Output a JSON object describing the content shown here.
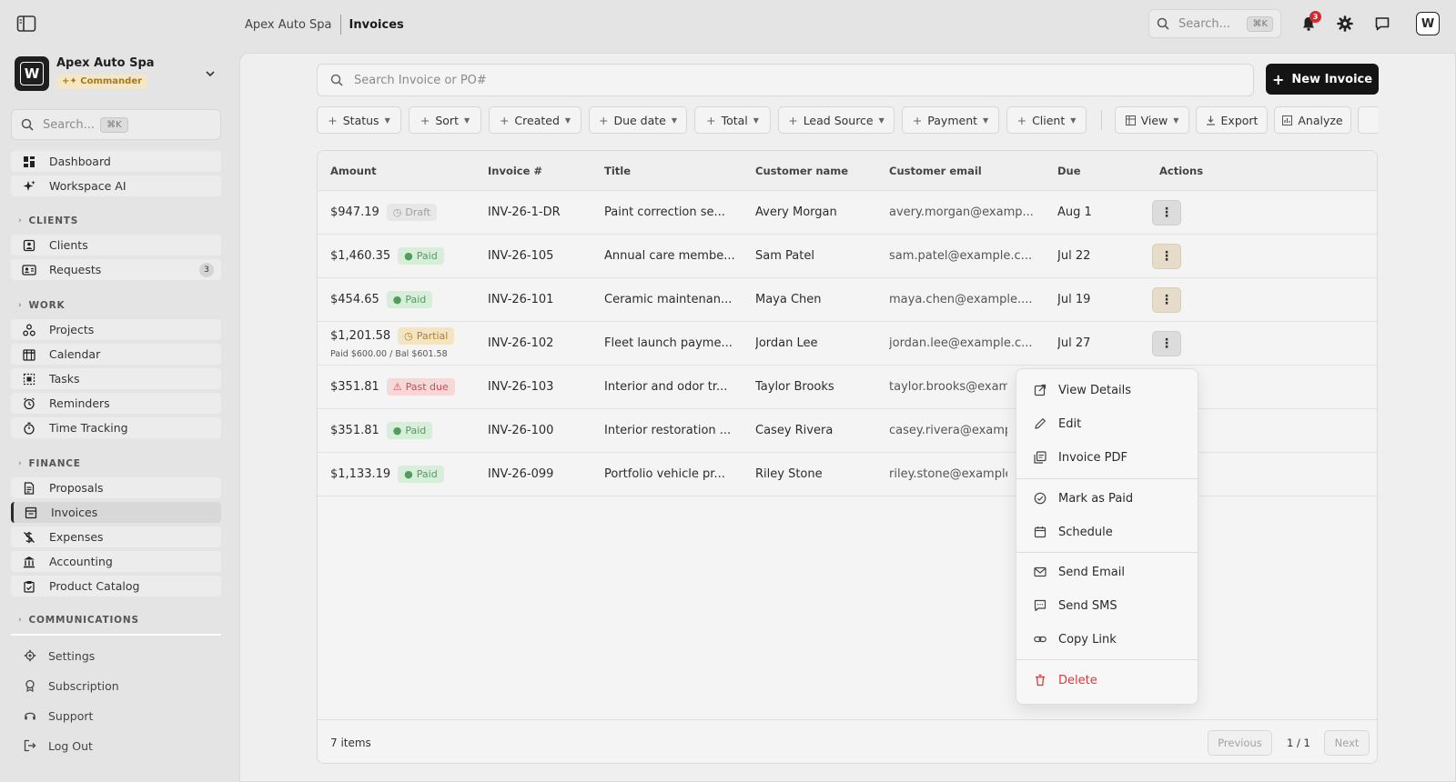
{
  "breadcrumb": {
    "org": "Apex Auto Spa",
    "page": "Invoices"
  },
  "topbar": {
    "search_placeholder": "Search...",
    "search_shortcut": "⌘K",
    "notification_count": "3",
    "avatar_letter": "W"
  },
  "workspace": {
    "name": "Apex Auto Spa",
    "role": "Commander",
    "logo_letter": "W"
  },
  "sidebar": {
    "search_placeholder": "Search...",
    "search_shortcut": "⌘K",
    "top_items": [
      {
        "label": "Dashboard",
        "icon": "dashboard-icon"
      },
      {
        "label": "Workspace AI",
        "icon": "sparkle-icon"
      }
    ],
    "sections": [
      {
        "title": "CLIENTS",
        "items": [
          {
            "label": "Clients"
          },
          {
            "label": "Requests",
            "count": "3"
          }
        ]
      },
      {
        "title": "WORK",
        "items": [
          {
            "label": "Projects"
          },
          {
            "label": "Calendar"
          },
          {
            "label": "Tasks"
          },
          {
            "label": "Reminders"
          },
          {
            "label": "Time Tracking"
          }
        ]
      },
      {
        "title": "FINANCE",
        "items": [
          {
            "label": "Proposals"
          },
          {
            "label": "Invoices"
          },
          {
            "label": "Expenses"
          },
          {
            "label": "Accounting"
          },
          {
            "label": "Product Catalog"
          }
        ]
      },
      {
        "title": "COMMUNICATIONS",
        "items": []
      }
    ],
    "footer": [
      {
        "label": "Settings"
      },
      {
        "label": "Subscription"
      },
      {
        "label": "Support"
      },
      {
        "label": "Log Out"
      }
    ]
  },
  "main": {
    "search_placeholder": "Search Invoice or PO#",
    "new_invoice_label": "New Invoice",
    "filters": [
      "Status",
      "Sort",
      "Created",
      "Due date",
      "Total",
      "Lead Source",
      "Payment",
      "Client"
    ],
    "view_label": "View",
    "export_label": "Export",
    "analyze_label": "Analyze"
  },
  "table": {
    "columns": [
      "Amount",
      "Invoice #",
      "Title",
      "Customer name",
      "Customer email",
      "Due",
      "Actions"
    ],
    "rows": [
      {
        "amount": "$947.19",
        "status": "Draft",
        "invoice": "INV-26-1-DR",
        "title": "Paint correction se...",
        "customer": "Avery Morgan",
        "email": "avery.morgan@examp...",
        "due": "Aug 1"
      },
      {
        "amount": "$1,460.35",
        "status": "Paid",
        "invoice": "INV-26-105",
        "title": "Annual care membe...",
        "customer": "Sam Patel",
        "email": "sam.patel@example.c...",
        "due": "Jul 22"
      },
      {
        "amount": "$454.65",
        "status": "Paid",
        "invoice": "INV-26-101",
        "title": "Ceramic maintenan...",
        "customer": "Maya Chen",
        "email": "maya.chen@example....",
        "due": "Jul 19"
      },
      {
        "amount": "$1,201.58",
        "status": "Partial",
        "sub": "Paid $600.00 / Bal $601.58",
        "invoice": "INV-26-102",
        "title": "Fleet launch payme...",
        "customer": "Jordan Lee",
        "email": "jordan.lee@example.c...",
        "due": "Jul 27"
      },
      {
        "amount": "$351.81",
        "status": "Past due",
        "invoice": "INV-26-103",
        "title": "Interior and odor tr...",
        "customer": "Taylor Brooks",
        "email": "taylor.brooks@exam",
        "due": ""
      },
      {
        "amount": "$351.81",
        "status": "Paid",
        "invoice": "INV-26-100",
        "title": "Interior restoration ...",
        "customer": "Casey Rivera",
        "email": "casey.rivera@examp",
        "due": ""
      },
      {
        "amount": "$1,133.19",
        "status": "Paid",
        "invoice": "INV-26-099",
        "title": "Portfolio vehicle pr...",
        "customer": "Riley Stone",
        "email": "riley.stone@example",
        "due": ""
      }
    ],
    "footer": {
      "items": "7 items",
      "previous": "Previous",
      "page": "1 / 1",
      "next": "Next"
    }
  },
  "action_menu": {
    "items": [
      {
        "label": "View Details",
        "icon": "external-link-icon"
      },
      {
        "label": "Edit",
        "icon": "pencil-icon"
      },
      {
        "label": "Invoice PDF",
        "icon": "pdf-icon"
      },
      {
        "label": "Mark as Paid",
        "icon": "check-circle-icon"
      },
      {
        "label": "Schedule",
        "icon": "calendar-icon"
      },
      {
        "label": "Send Email",
        "icon": "mail-icon"
      },
      {
        "label": "Send SMS",
        "icon": "message-icon"
      },
      {
        "label": "Copy Link",
        "icon": "link-icon"
      },
      {
        "label": "Delete",
        "icon": "trash-icon"
      }
    ]
  },
  "colors": {
    "primary_button": "#141414",
    "paid": "#4f9e5b",
    "partial": "#b58021",
    "past_due": "#d3494d",
    "danger": "#d83a3a",
    "notification": "#d8262c"
  }
}
